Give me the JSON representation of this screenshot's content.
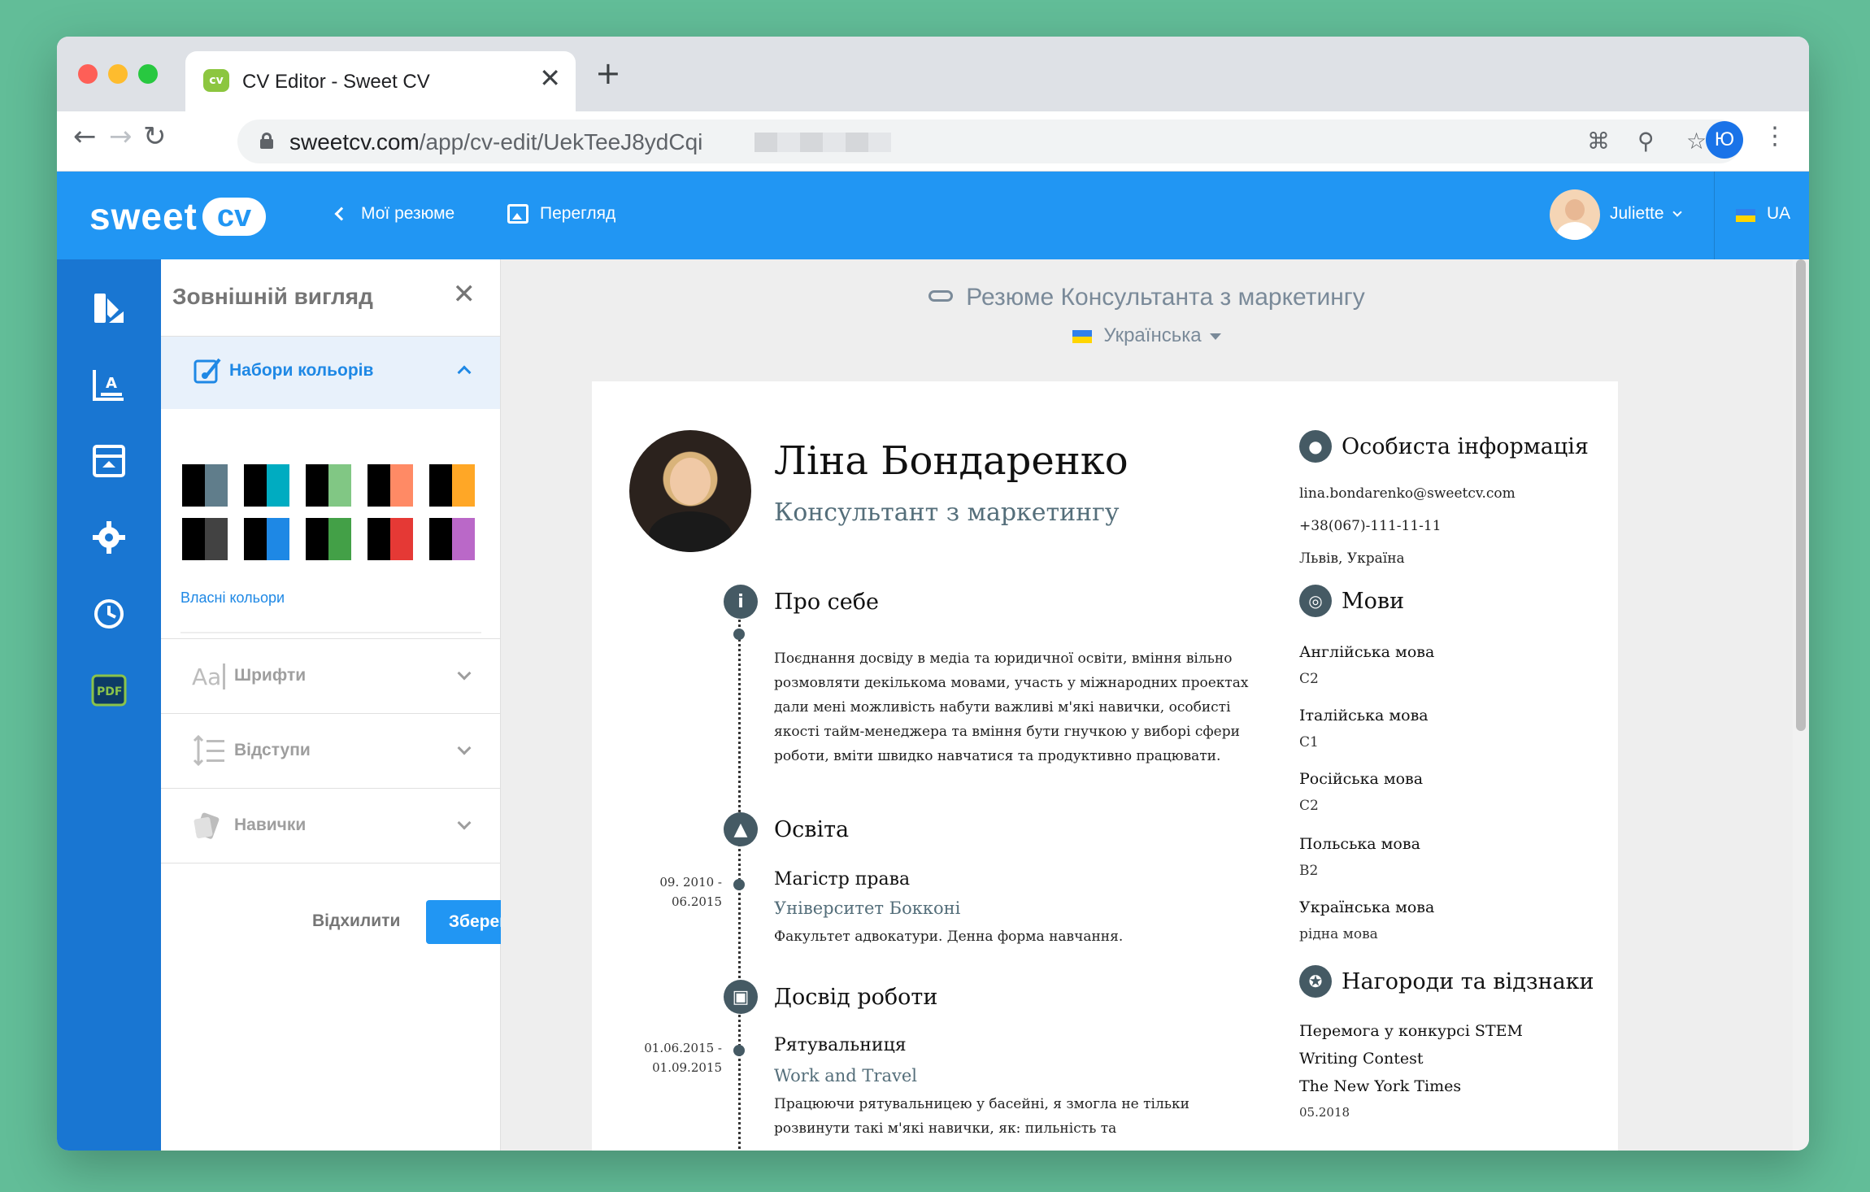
{
  "browser": {
    "tab_title": "CV Editor - Sweet CV",
    "favicon_text": "cv",
    "url_host": "sweetcv.com",
    "url_path": "/app/cv-edit/UekTeeJ8ydCqi",
    "profile_initial": "Ю"
  },
  "header": {
    "logo_sweet": "sweet",
    "logo_cv": "cv",
    "my_resumes": "Мої резюме",
    "preview": "Перегляд",
    "user_name": "Juliette",
    "lang_code": "UA"
  },
  "panel": {
    "title": "Зовнішній вигляд",
    "color_sets": "Набори кольорів",
    "own_colors": "Власні кольори",
    "fonts": "Шрифти",
    "spacing": "Відступи",
    "skills": "Навички",
    "cancel": "Відхилити",
    "save": "Зберегти",
    "swatches": [
      [
        "#000000",
        "#607d8b"
      ],
      [
        "#000000",
        "#00acc1"
      ],
      [
        "#000000",
        "#81c784"
      ],
      [
        "#000000",
        "#ff8a65"
      ],
      [
        "#000000",
        "#ffa726"
      ],
      [
        "#000000",
        "#424242"
      ],
      [
        "#000000",
        "#1e88e5"
      ],
      [
        "#000000",
        "#43a047"
      ],
      [
        "#000000",
        "#e53935"
      ],
      [
        "#000000",
        "#ba68c8"
      ]
    ]
  },
  "canvas": {
    "cv_title": "Резюме Консультанта з маркетингу",
    "cv_language": "Українська"
  },
  "cv": {
    "name": "Ліна Бондаренко",
    "role": "Консультант з маркетингу",
    "about_title": "Про себе",
    "about_text": "Поєднання досвіду в медіа та юридичної освіти, вміння вільно розмовляти декількома мовами, участь у міжнародних проектах дали мені можливість набути важливі м'які навички, особисті якості тайм-менеджера та вміння бути гнучкою у виборі сфери роботи, вміти швидко навчатися та продуктивно працювати.",
    "education_title": "Освіта",
    "edu_date_start": "09. 2010 -",
    "edu_date_end": "06.2015",
    "edu_degree": "Магістр права",
    "edu_school": "Університет Бокконі",
    "edu_desc": "Факультет адвокатури. Денна форма навчання.",
    "work_title": "Досвід роботи",
    "work_date_start": "01.06.2015 -",
    "work_date_end": "01.09.2015",
    "work_position": "Рятувальниця",
    "work_company": "Work and Travel",
    "work_desc": "Працюючи рятувальницею у басейні, я змогла не тільки розвинути такі м'які навички, як: пильність та",
    "personal_title": "Особиста інформація",
    "email": "lina.bondarenko@sweetcv.com",
    "phone": "+38(067)-111-11-11",
    "city": "Львів, Україна",
    "languages_title": "Мови",
    "languages": [
      {
        "name": "Англійська мова",
        "level": "C2"
      },
      {
        "name": "Італійська мова",
        "level": "C1"
      },
      {
        "name": "Російська мова",
        "level": "C2"
      },
      {
        "name": "Польська мова",
        "level": "B2"
      },
      {
        "name": "Українська мова",
        "level": "рідна мова"
      }
    ],
    "awards_title": "Нагороди та відзнаки",
    "award_name": "Перемога у конкурсі STEM",
    "award_line2": "Writing Contest",
    "award_line3": "The New York Times",
    "award_date": "05.2018"
  }
}
